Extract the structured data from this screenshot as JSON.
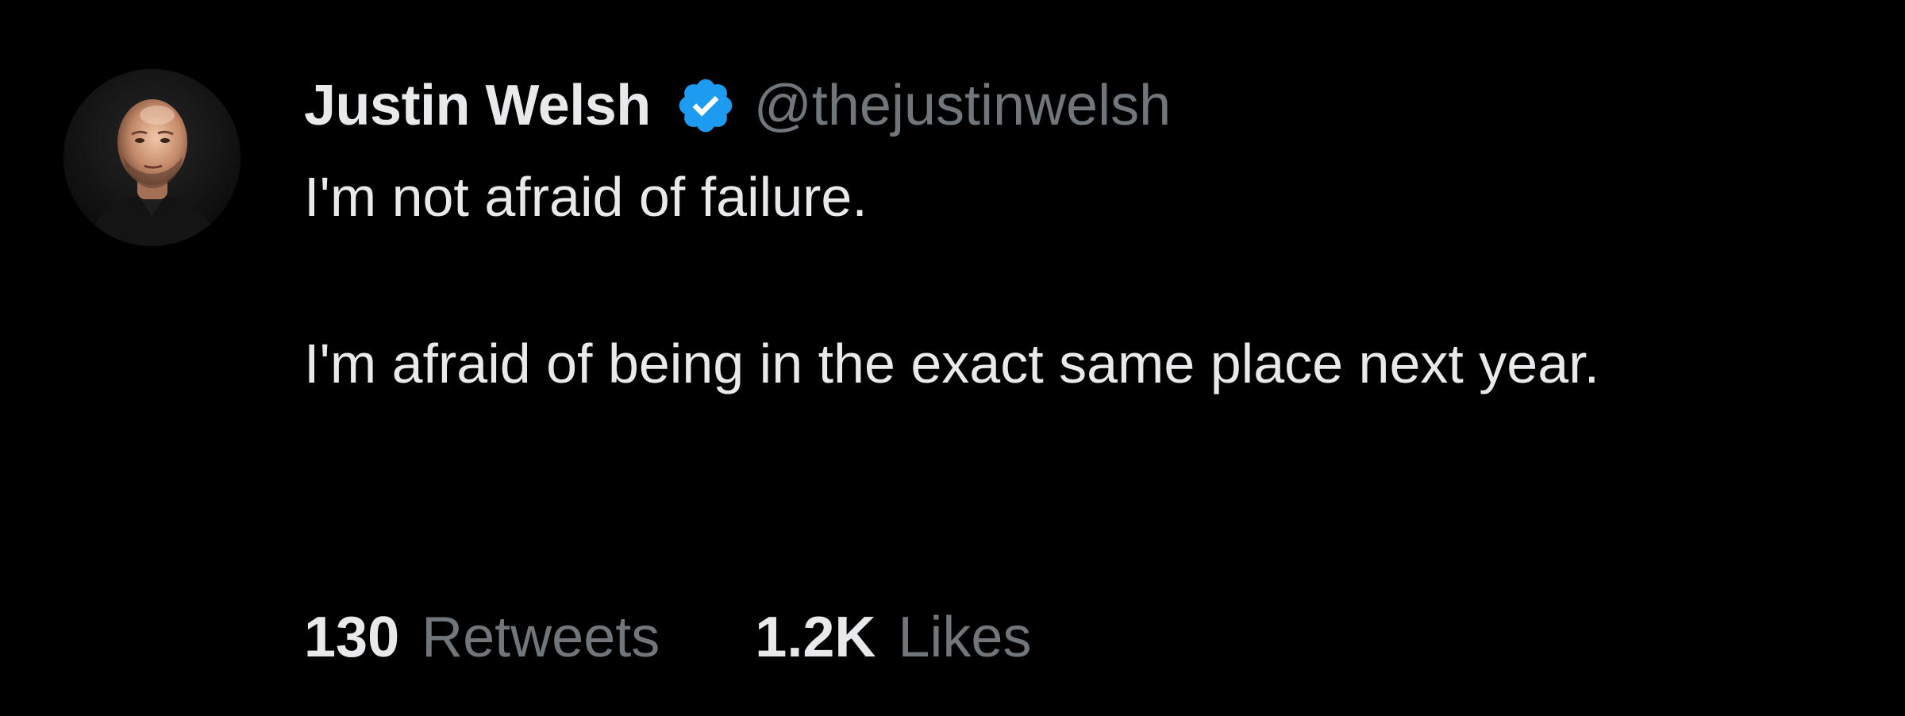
{
  "tweet": {
    "author": {
      "display_name": "Justin Welsh",
      "handle": "@thejustinwelsh",
      "verified": true,
      "verified_badge_color": "#1d9bf0"
    },
    "text_lines": [
      "I'm not afraid of failure.",
      "I'm afraid of being in the exact same place next year."
    ],
    "stats": {
      "retweets_count": "130",
      "retweets_label": "Retweets",
      "likes_count": "1.2K",
      "likes_label": "Likes"
    }
  },
  "theme": {
    "background": "#000000",
    "primary_text": "#e7e9ea",
    "secondary_text": "#71767b",
    "accent": "#1d9bf0"
  },
  "icons": {
    "avatar": "profile-photo",
    "badge": "verified-check-icon"
  }
}
